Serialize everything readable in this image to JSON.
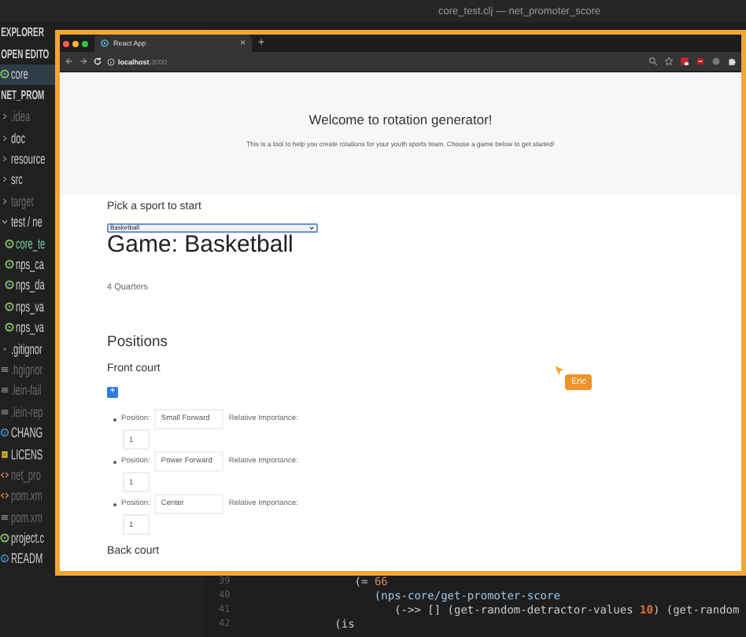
{
  "title_bar": {
    "title": "core_test.clj — net_promoter_score"
  },
  "sidebar": {
    "header": "EXPLORER",
    "open_editors": {
      "label": "OPEN EDITO",
      "items": [
        {
          "label": "core",
          "kind": "clj",
          "ignored": false,
          "modified": false,
          "selected": true
        }
      ]
    },
    "project": {
      "label": "NET_PROM",
      "items": [
        {
          "label": ".idea",
          "kind": "folder",
          "ignored": true,
          "modified": false,
          "expanded": false
        },
        {
          "label": "doc",
          "kind": "folder",
          "ignored": false,
          "modified": false,
          "expanded": false
        },
        {
          "label": "resource",
          "kind": "folder",
          "ignored": false,
          "modified": false,
          "expanded": false
        },
        {
          "label": "src",
          "kind": "folder",
          "ignored": false,
          "modified": false,
          "expanded": false
        },
        {
          "label": "target",
          "kind": "folder",
          "ignored": true,
          "modified": false,
          "expanded": false
        },
        {
          "label": "test / ne",
          "kind": "folder",
          "ignored": false,
          "modified": false,
          "expanded": true,
          "children": [
            {
              "label": "core_te",
              "kind": "clj",
              "ignored": false,
              "modified": true
            },
            {
              "label": "nps_ca",
              "kind": "clj",
              "ignored": false,
              "modified": false
            },
            {
              "label": "nps_da",
              "kind": "clj",
              "ignored": false,
              "modified": false
            },
            {
              "label": "nps_va",
              "kind": "clj",
              "ignored": false,
              "modified": false
            },
            {
              "label": "nps_va",
              "kind": "clj",
              "ignored": false,
              "modified": false
            }
          ]
        },
        {
          "label": ".gitignor",
          "kind": "plain",
          "ignored": false,
          "modified": false
        },
        {
          "label": ".hgignor",
          "kind": "text",
          "ignored": true,
          "modified": false
        },
        {
          "label": ".lein-fail",
          "kind": "text",
          "ignored": true,
          "modified": false
        },
        {
          "label": ".lein-rep",
          "kind": "text",
          "ignored": true,
          "modified": false
        },
        {
          "label": "CHANG",
          "kind": "info",
          "ignored": false,
          "modified": false
        },
        {
          "label": "LICENS",
          "kind": "license",
          "ignored": false,
          "modified": false
        },
        {
          "label": "net_pro",
          "kind": "xml",
          "ignored": true,
          "modified": false
        },
        {
          "label": "pom.xm",
          "kind": "xml",
          "ignored": true,
          "modified": false
        },
        {
          "label": "pom.xm",
          "kind": "text",
          "ignored": true,
          "modified": false
        },
        {
          "label": "project.c",
          "kind": "clj",
          "ignored": false,
          "modified": false
        },
        {
          "label": "READM",
          "kind": "info",
          "ignored": false,
          "modified": false
        }
      ]
    }
  },
  "editor": {
    "lines": [
      {
        "number": "39",
        "tokens": [
          {
            "text": "      (= ",
            "kind": "plain"
          },
          {
            "text": "66",
            "kind": "number"
          }
        ]
      },
      {
        "number": "40",
        "tokens": [
          {
            "text": "         (nps-core/get-promoter-score",
            "kind": "call"
          }
        ]
      },
      {
        "number": "41",
        "tokens": [
          {
            "text": "            (->> [] (get-random-detractor-values ",
            "kind": "plain"
          },
          {
            "text": "10",
            "kind": "literal"
          },
          {
            "text": ") (get-random",
            "kind": "plain"
          }
        ]
      },
      {
        "number": "42",
        "tokens": [
          {
            "text": "   (is",
            "kind": "plain"
          }
        ]
      }
    ]
  },
  "browser": {
    "tab": {
      "title": "React App",
      "close": "×",
      "new_tab": "+"
    },
    "url": {
      "host": "localhost",
      "port": ":3000"
    },
    "page": {
      "heading": "Welcome to rotation generator!",
      "intro": "This is a tool to help you create rotations for your youth sports team. Choose a game below to get started!",
      "sport_prompt": "Pick a sport to start",
      "sport_select": {
        "value": "Basketball"
      },
      "game_title": "Game: Basketball",
      "periods": "4 Quarters",
      "positions_heading": "Positions",
      "groups": [
        {
          "title": "Front court",
          "add_label": "+",
          "positions": [
            {
              "label": "Position:",
              "name": "Small Forward",
              "importance_label": "Relative Importance:",
              "importance": "1"
            },
            {
              "label": "Position:",
              "name": "Power Forward",
              "importance_label": "Relative Importance:",
              "importance": "1"
            },
            {
              "label": "Position:",
              "name": "Center",
              "importance_label": "Relative Importance:",
              "importance": "1"
            }
          ]
        },
        {
          "title": "Back court"
        }
      ]
    }
  },
  "cursor": {
    "name": "Eric"
  }
}
